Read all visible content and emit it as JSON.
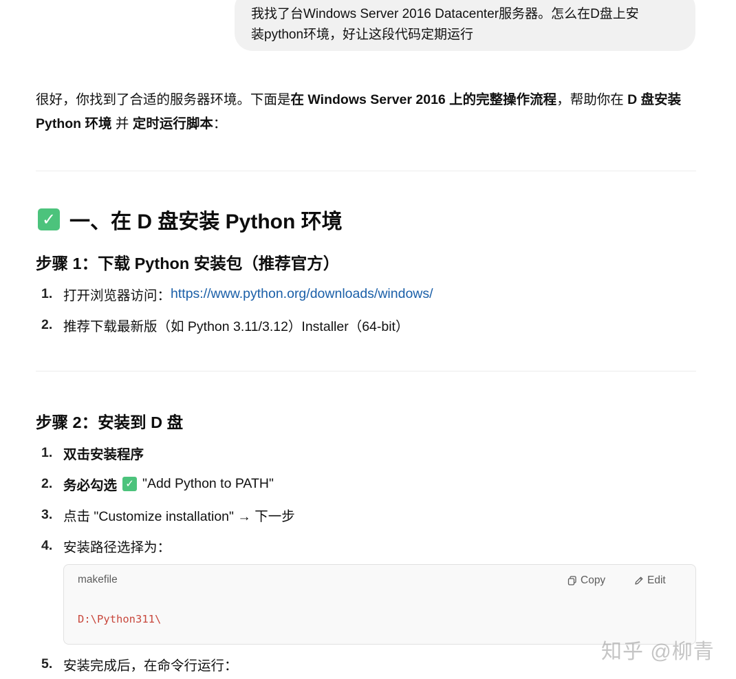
{
  "user_message": {
    "line1": "我找了台Windows Server 2016 Datacenter服务器。怎么在D盘上安",
    "line2": "装python环境，好让这段代码定期运行"
  },
  "intro": {
    "p1": "很好，你找到了合适的服务器环境。下面是",
    "b1": "在 Windows Server 2016 上的完整操作流程",
    "p2": "，帮助你在 ",
    "b2": "D 盘安装 Python 环境",
    "p3": " 并 ",
    "b3": "定时运行脚本",
    "p4": "："
  },
  "section1": {
    "icon_text": "✓",
    "title": "一、在 D 盘安装 Python 环境"
  },
  "step1": {
    "title": "步骤 1：下载 Python 安装包（推荐官方）",
    "items": [
      {
        "num": "1.",
        "text": "打开浏览器访问：",
        "link": "https://www.python.org/downloads/windows/"
      },
      {
        "num": "2.",
        "text": "推荐下载最新版（如 Python 3.11/3.12）Installer（64-bit）"
      }
    ]
  },
  "step2": {
    "title": "步骤 2：安装到 D 盘",
    "items": [
      {
        "num": "1.",
        "text": "双击安装程序"
      },
      {
        "num": "2.",
        "bold": "务必勾选",
        "icon": "✓",
        "text": "\"Add Python to PATH\""
      },
      {
        "num": "3.",
        "text": "点击 \"Customize installation\" → 下一步"
      },
      {
        "num": "4.",
        "text": "安装路径选择为："
      },
      {
        "num": "5.",
        "text": "安装完成后，在命令行运行："
      }
    ]
  },
  "code": {
    "language": "makefile",
    "copy_label": "Copy",
    "edit_label": "Edit",
    "content": "D:\\Python311\\"
  },
  "watermark": "知乎 @柳青",
  "colors": {
    "accent_check": "#4cc37c",
    "link": "#1a5fa8",
    "code_text": "#c8473c"
  }
}
